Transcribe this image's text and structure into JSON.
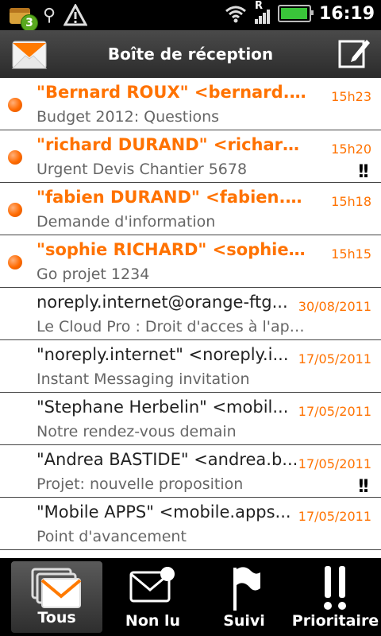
{
  "status_bar": {
    "notification_count": "3",
    "time": "16:19",
    "signal_label": "R"
  },
  "header": {
    "title": "Boîte de réception"
  },
  "messages": [
    {
      "sender": "\"Bernard ROUX\" <bernard.roux@...",
      "subject": "Budget 2012: Questions",
      "date": "15h23",
      "unread": true,
      "priority": ""
    },
    {
      "sender": "\"richard DURAND\" <richard.du...",
      "subject": "Urgent Devis Chantier 5678",
      "date": "15h20",
      "unread": true,
      "priority": "!!"
    },
    {
      "sender": "\"fabien DURAND\" <fabien.dura...",
      "subject": "Demande d'information",
      "date": "15h18",
      "unread": true,
      "priority": ""
    },
    {
      "sender": "\"sophie RICHARD\" <sophie.ric...",
      "subject": "Go projet 1234",
      "date": "15h15",
      "unread": true,
      "priority": ""
    },
    {
      "sender": "noreply.internet@orange-ftg...",
      "subject": "Le Cloud Pro : Droit d'acces à l'app...",
      "date": "30/08/2011",
      "unread": false,
      "priority": ""
    },
    {
      "sender": "\"noreply.internet\" <noreply.i...",
      "subject": "Instant Messaging invitation",
      "date": "17/05/2011",
      "unread": false,
      "priority": ""
    },
    {
      "sender": "\"Stephane Herbelin\" <mobil...",
      "subject": "Notre rendez-vous demain",
      "date": "17/05/2011",
      "unread": false,
      "priority": ""
    },
    {
      "sender": "\"Andrea BASTIDE\" <andrea.b...",
      "subject": "Projet: nouvelle proposition",
      "date": "17/05/2011",
      "unread": false,
      "priority": "!!"
    },
    {
      "sender": "\"Mobile APPS\" <mobile.apps...",
      "subject": "Point d'avancement",
      "date": "17/05/2011",
      "unread": false,
      "priority": ""
    }
  ],
  "tabs": [
    {
      "label": "Tous",
      "icon": "all-mail-icon",
      "active": true
    },
    {
      "label": "Non lu",
      "icon": "unread-mail-icon",
      "active": false
    },
    {
      "label": "Suivi",
      "icon": "flag-icon",
      "active": false
    },
    {
      "label": "Prioritaire",
      "icon": "priority-icon",
      "active": false
    }
  ],
  "colors": {
    "accent": "#ff7200",
    "unread_dot": "#ff6a00",
    "header_bg": "#3a3a3a",
    "tab_bg": "#000000"
  }
}
